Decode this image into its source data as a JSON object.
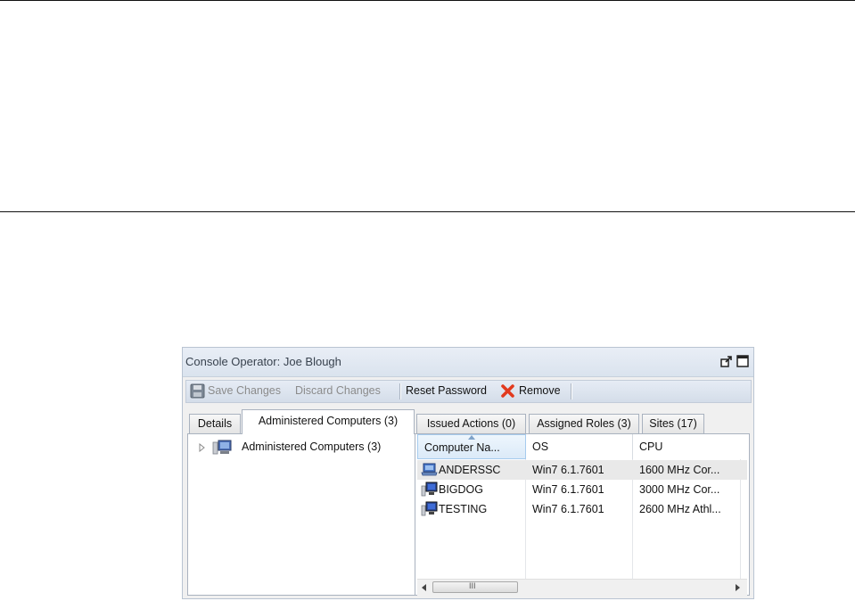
{
  "window": {
    "title": "Console Operator: Joe Blough"
  },
  "toolbar": {
    "save_label": "Save Changes",
    "discard_label": "Discard Changes",
    "reset_label": "Reset Password",
    "remove_label": "Remove"
  },
  "tabs": [
    {
      "label": "Details",
      "active": false
    },
    {
      "label": "Administered Computers (3)",
      "active": true
    },
    {
      "label": "Issued Actions (0)",
      "active": false
    },
    {
      "label": "Assigned Roles (3)",
      "active": false
    },
    {
      "label": "Sites (17)",
      "active": false
    }
  ],
  "tree": {
    "root_label": "Administered Computers (3)"
  },
  "grid": {
    "columns": [
      "Computer Na...",
      "OS",
      "CPU"
    ],
    "sorted_column": "Computer Na...",
    "rows": [
      {
        "name": "ANDERSSC",
        "os": "Win7 6.1.7601",
        "cpu": "1600 MHz Cor...",
        "selected": true,
        "icon": "laptop-icon"
      },
      {
        "name": "BIGDOG",
        "os": "Win7 6.1.7601",
        "cpu": "3000 MHz Cor...",
        "selected": false,
        "icon": "desktop-computer-icon"
      },
      {
        "name": "TESTING",
        "os": "Win7 6.1.7601",
        "cpu": "2600 MHz Athl...",
        "selected": false,
        "icon": "desktop-computer-icon"
      }
    ],
    "scroll_grip": "III"
  },
  "colors": {
    "title_bar": "#dae3ee",
    "toolbar": "#d4dde9",
    "selected_row": "#e9e9e9",
    "sorted_header": "#dbeaf8",
    "remove_icon": "#e23a1e"
  }
}
